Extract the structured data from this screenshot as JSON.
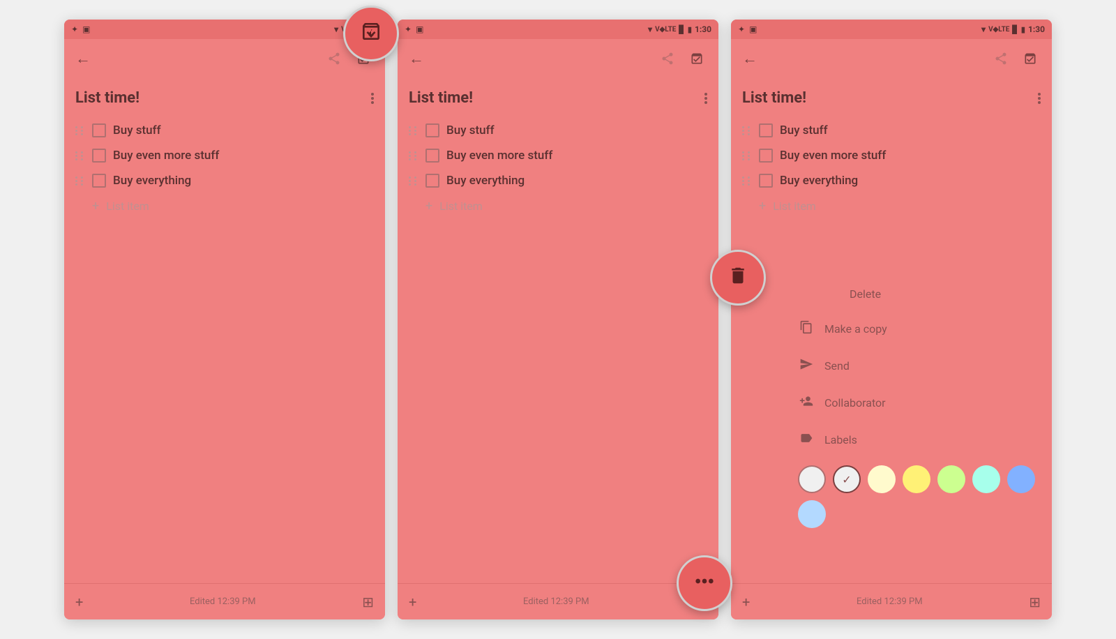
{
  "colors": {
    "bg": "#f08080",
    "status_bar": "#e87070",
    "text_dark": "#5a3030",
    "text_light": "#c09090",
    "icon": "#8a5050",
    "fab_bg": "#e86060"
  },
  "phone1": {
    "status": {
      "time": "",
      "lte": "V♦LTE"
    },
    "title": "List time!",
    "items": [
      {
        "text": "Buy stuff"
      },
      {
        "text": "Buy even more stuff"
      },
      {
        "text": "Buy everything"
      }
    ],
    "add_placeholder": "List item",
    "edited": "Edited 12:39 PM",
    "fab_label": "archive-fab"
  },
  "phone2": {
    "status": {
      "time": "1:30"
    },
    "title": "List time!",
    "items": [
      {
        "text": "Buy stuff"
      },
      {
        "text": "Buy even more stuff"
      },
      {
        "text": "Buy everything"
      }
    ],
    "add_placeholder": "List item",
    "edited": "Edited 12:39 PM",
    "fab_label": "dots-fab"
  },
  "phone3": {
    "status": {
      "time": "1:30"
    },
    "title": "List time!",
    "items": [
      {
        "text": "Buy stuff"
      },
      {
        "text": "Buy even more stuff"
      },
      {
        "text": "Buy everything"
      }
    ],
    "add_placeholder": "List item",
    "edited": "Edited 12:39 PM",
    "menu": {
      "delete": "Delete",
      "make_copy": "Make a copy",
      "send": "Send",
      "collaborator": "Collaborator",
      "labels": "Labels"
    },
    "swatches": [
      "#ffffff",
      "#ffffff",
      "#ffffaa",
      "#ffff88",
      "#ccff88",
      "#aaeeff",
      "#88bbff",
      "#ccddff"
    ]
  }
}
